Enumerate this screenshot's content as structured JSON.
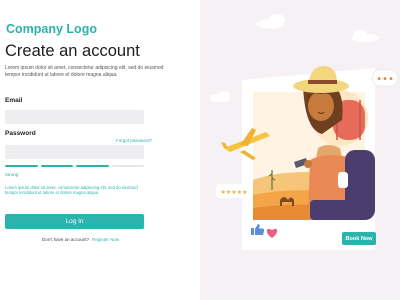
{
  "brand": {
    "logo_text": "Company Logo"
  },
  "form": {
    "title": "Create an account",
    "subtitle": "Lorem ipsum dolor sit amet, consectetur adipiscing elit, sed do eiusmod tempor incididunt ut labore et dolore magna aliqua.",
    "email_label": "Email",
    "email_value": "",
    "password_label": "Password",
    "password_value": "",
    "forgot_link": "Forgot password?",
    "strength_label": "Strong",
    "strength_level": 3,
    "strength_max": 4,
    "hint_text": "Lorem ipsum dolor sit amet, consectetur adipiscing elit, sed do eiusmod tempor incididunt ut labore et dolore magna aliqua.",
    "login_button": "Log In",
    "no_account_text": "Don't have an account?",
    "register_link": "Register Now"
  },
  "illustration": {
    "rating_stars": "★★★★★",
    "chat_dots": "•••",
    "book_button": "Book Now",
    "like_icon": "thumbs-up-icon",
    "heart_icon": "heart-icon"
  },
  "colors": {
    "accent": "#2bb3ae",
    "panel_bg": "#f5f1f4",
    "desert": "#f3a548",
    "hat": "#f3d77e",
    "backpack": "#4b3d6e",
    "sleeping_bag": "#e76b5b",
    "plane": "#f5c542"
  }
}
